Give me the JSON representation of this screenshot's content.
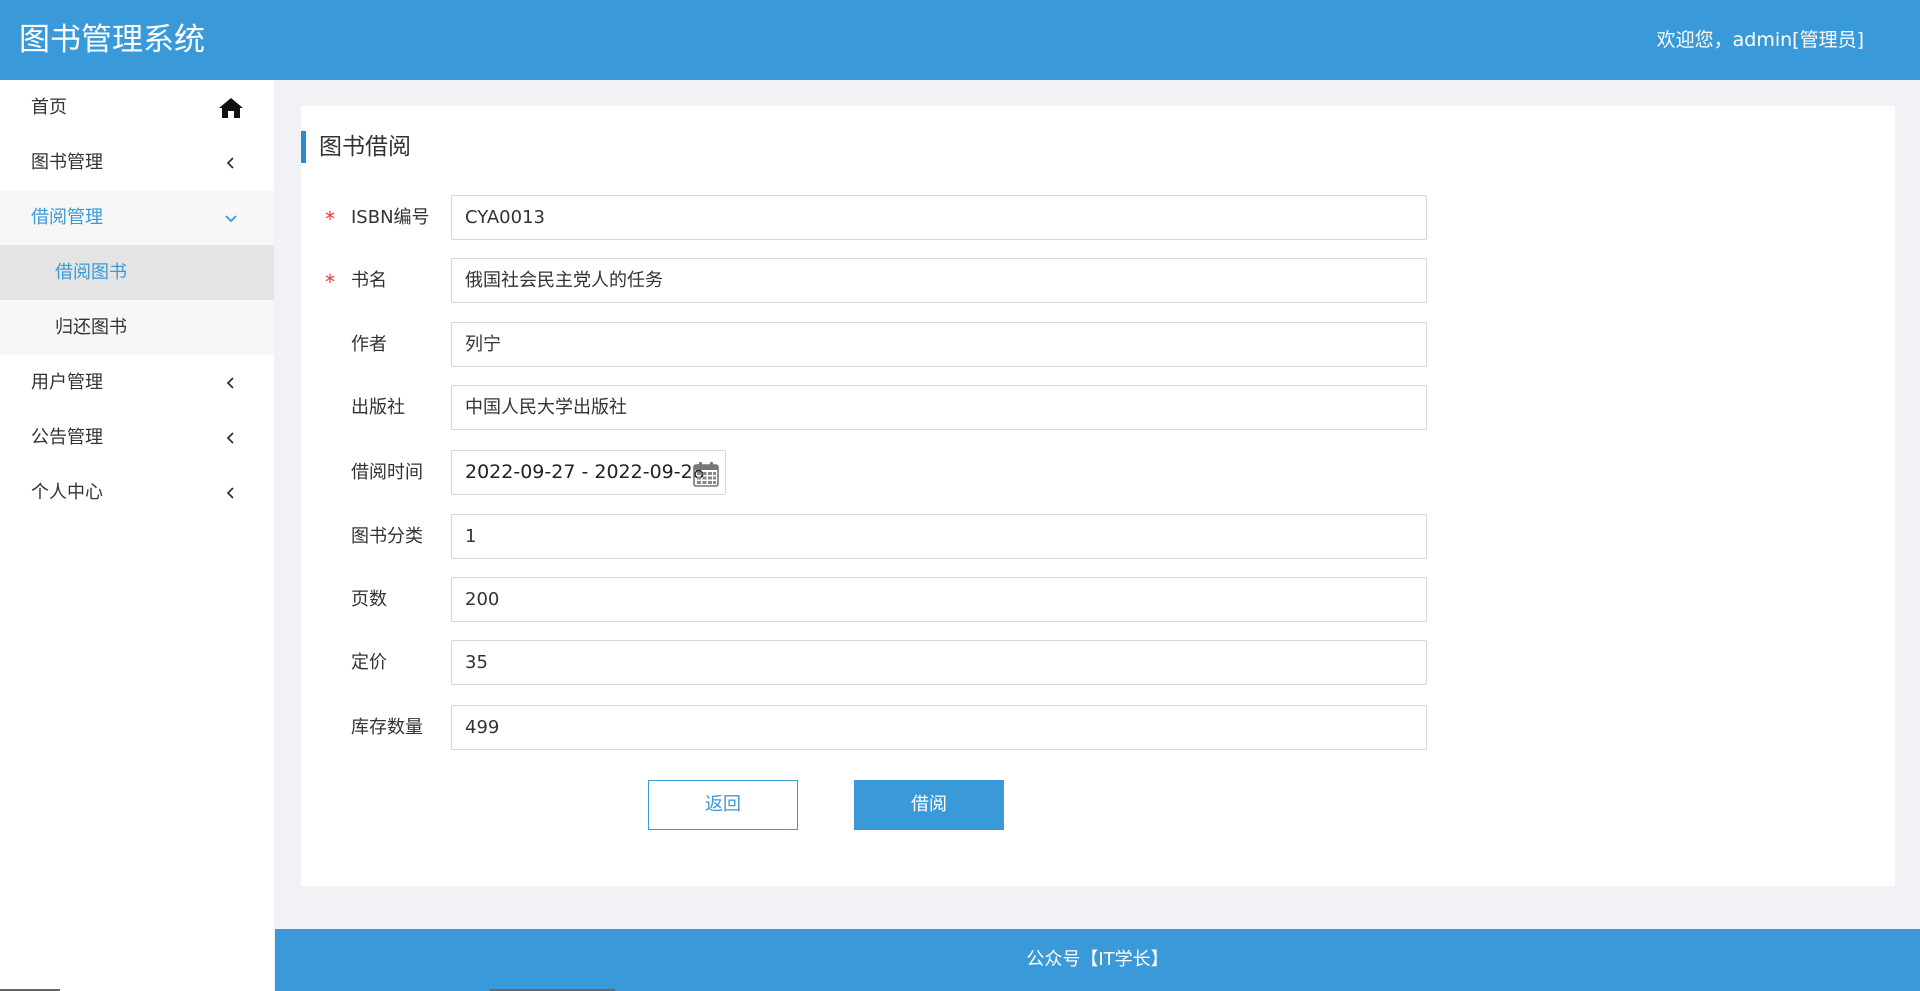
{
  "header": {
    "app_title": "图书管理系统",
    "welcome": "欢迎您，admin[管理员]"
  },
  "sidebar": {
    "items": [
      {
        "label": "首页",
        "icon": "home-icon"
      },
      {
        "label": "图书管理",
        "icon": "chevron-left-icon"
      },
      {
        "label": "借阅管理",
        "icon": "chevron-down-icon",
        "expanded": true,
        "children": [
          {
            "label": "借阅图书",
            "active": true
          },
          {
            "label": "归还图书"
          }
        ]
      },
      {
        "label": "用户管理",
        "icon": "chevron-left-icon"
      },
      {
        "label": "公告管理",
        "icon": "chevron-left-icon"
      },
      {
        "label": "个人中心",
        "icon": "chevron-left-icon"
      }
    ]
  },
  "card": {
    "title": "图书借阅",
    "fields": [
      {
        "label": "ISBN编号",
        "value": "CYA0013",
        "required": true
      },
      {
        "label": "书名",
        "value": "俄国社会民主党人的任务",
        "required": true
      },
      {
        "label": "作者",
        "value": "列宁"
      },
      {
        "label": "出版社",
        "value": "中国人民大学出版社"
      },
      {
        "label": "借阅时间",
        "value": "2022-09-27 - 2022-09-28"
      },
      {
        "label": "图书分类",
        "value": "1"
      },
      {
        "label": "页数",
        "value": "200"
      },
      {
        "label": "定价",
        "value": "35"
      },
      {
        "label": "库存数量",
        "value": "499"
      }
    ],
    "required_mark": "*",
    "buttons": {
      "back": "返回",
      "borrow": "借阅"
    }
  },
  "footer": {
    "text": "公众号【IT学长】"
  },
  "colors": {
    "primary": "#3a9ad9",
    "required": "#e33333"
  }
}
